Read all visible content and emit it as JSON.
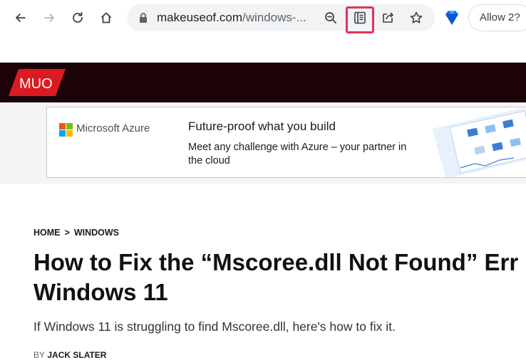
{
  "browser": {
    "url_host": "makeuseof.com",
    "url_rest": "/windows-...",
    "allow_label": "Allow 2?",
    "icons": [
      "back-icon",
      "forward-icon",
      "reload-icon",
      "home-icon",
      "lock-icon",
      "zoom-icon",
      "reading-mode-icon",
      "share-icon",
      "star-icon",
      "extension-icon"
    ]
  },
  "site": {
    "logo_text": "MUO",
    "brand_color": "#dc1a22"
  },
  "ad": {
    "brand": "Microsoft Azure",
    "title": "Future-proof what you build",
    "body": "Meet any challenge with Azure – your partner in the cloud"
  },
  "article": {
    "breadcrumb_home": "HOME",
    "breadcrumb_sep": ">",
    "breadcrumb_section": "WINDOWS",
    "title_line1": "How to Fix the “Mscoree.dll Not Found” Err",
    "title_line2": "Windows 11",
    "subtitle": "If Windows 11 is struggling to find Mscoree.dll, here's how to fix it.",
    "byline_prefix": "BY",
    "author": "JACK SLATER"
  }
}
